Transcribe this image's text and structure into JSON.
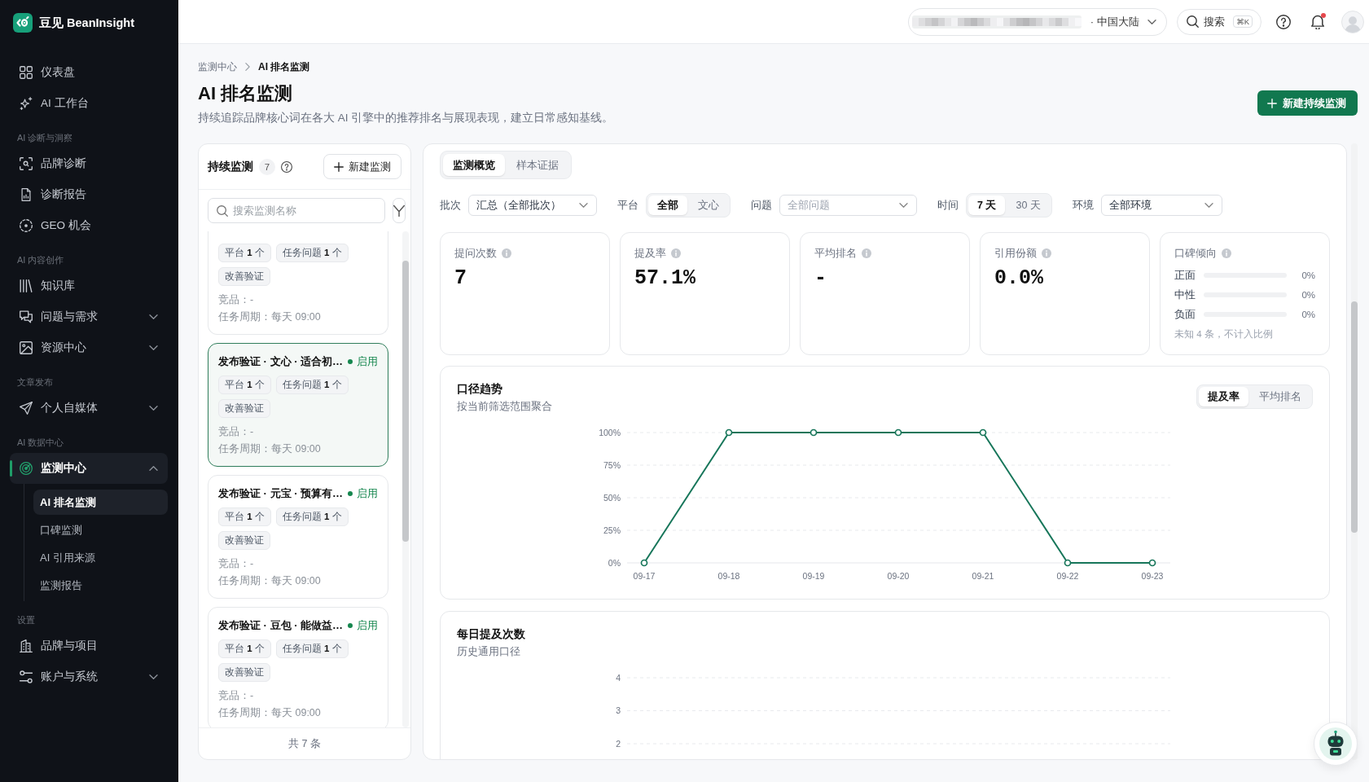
{
  "sidebar": {
    "brand": "豆见 BeanInsight",
    "sections": [
      {
        "items": [
          {
            "label": "仪表盘",
            "selected": false
          },
          {
            "label": "AI 工作台",
            "selected": false
          }
        ]
      },
      {
        "title": "AI 诊断与洞察",
        "items": [
          {
            "label": "品牌诊断",
            "selected": false
          },
          {
            "label": "诊断报告",
            "selected": false
          },
          {
            "label": "GEO 机会",
            "selected": false
          }
        ]
      },
      {
        "title": "AI 内容创作",
        "items": [
          {
            "label": "知识库",
            "selected": false
          },
          {
            "label": "问题与需求",
            "selected": false,
            "expanded": false
          },
          {
            "label": "资源中心",
            "selected": false,
            "expanded": false
          }
        ]
      },
      {
        "title": "文章发布",
        "items": [
          {
            "label": "个人自媒体",
            "selected": false,
            "expanded": false
          }
        ]
      },
      {
        "title": "AI 数据中心",
        "items": [
          {
            "label": "监测中心",
            "selected": true,
            "expanded": true,
            "children": [
              {
                "label": "AI 排名监测",
                "selected": true
              },
              {
                "label": "口碑监测",
                "selected": false
              },
              {
                "label": "AI 引用来源",
                "selected": false
              },
              {
                "label": "监测报告",
                "selected": false
              }
            ]
          }
        ]
      },
      {
        "title": "设置",
        "items": [
          {
            "label": "品牌与项目",
            "selected": false
          },
          {
            "label": "账户与系统",
            "selected": false,
            "expanded": false
          }
        ]
      }
    ]
  },
  "header": {
    "region": "· 中国大陆",
    "search": {
      "label": "搜索",
      "shortcut": "⌘K"
    },
    "notifications": {
      "unread": true
    }
  },
  "page": {
    "breadcrumb": [
      "监测中心",
      "AI 排名监测"
    ],
    "title": "AI 排名监测",
    "subtitle": "持续追踪品牌核心词在各大 AI 引擎中的推荐排名与展现表现，建立日常感知基线。",
    "primary_button": "新建持续监测"
  },
  "monitors": {
    "title": "持续监测",
    "count": "7",
    "new_button": "新建监测",
    "search": {
      "placeholder": "搜索监测名称"
    },
    "items": [
      {
        "kind": "partial",
        "selected": false,
        "tags": [
          "平台 **1** 个",
          "任务问题 **1** 个",
          "改善验证"
        ],
        "competitors": "竞品：-",
        "schedule": "任务周期：每天 09:00"
      },
      {
        "kind": "full",
        "selected": true,
        "title": "发布验证 · 文心 · 适合初…",
        "status": "启用",
        "tags": [
          "平台 **1** 个",
          "任务问题 **1** 个",
          "改善验证"
        ],
        "competitors": "竞品：-",
        "schedule": "任务周期：每天 09:00"
      },
      {
        "kind": "full",
        "selected": false,
        "title": "发布验证 · 元宝 · 预算有…",
        "status": "启用",
        "tags": [
          "平台 **1** 个",
          "任务问题 **1** 个",
          "改善验证"
        ],
        "competitors": "竞品：-",
        "schedule": "任务周期：每天 09:00"
      },
      {
        "kind": "full",
        "selected": false,
        "title": "发布验证 · 豆包 · 能做益…",
        "status": "启用",
        "tags": [
          "平台 **1** 个",
          "任务问题 **1** 个",
          "改善验证"
        ],
        "competitors": "竞品：-",
        "schedule": "任务周期：每天 09:00"
      }
    ],
    "total": "共 7 条"
  },
  "overview": {
    "tabs": [
      {
        "label": "监测概览",
        "selected": true
      },
      {
        "label": "样本证据",
        "selected": false
      }
    ],
    "filters": [
      {
        "kind": "select",
        "label": "批次",
        "value": "汇总（全部批次）"
      },
      {
        "kind": "segmented",
        "label": "平台",
        "options": [
          {
            "label": "全部",
            "selected": true
          },
          {
            "label": "文心",
            "selected": false
          }
        ]
      },
      {
        "kind": "select",
        "label": "问题",
        "placeholder": "全部问题"
      },
      {
        "kind": "segmented",
        "label": "时间",
        "options": [
          {
            "label": "7 天",
            "selected": true
          },
          {
            "label": "30 天",
            "selected": false
          }
        ]
      },
      {
        "kind": "select",
        "label": "环境",
        "value": "全部环境"
      }
    ],
    "stats": [
      {
        "kind": "number",
        "label": "提问次数",
        "value": "7"
      },
      {
        "kind": "number",
        "label": "提及率",
        "value": "57.1%"
      },
      {
        "kind": "number",
        "label": "平均排名",
        "value": "-"
      },
      {
        "kind": "number",
        "label": "引用份额",
        "value": "0.0%"
      },
      {
        "kind": "sentiment",
        "label": "口碑倾向",
        "rows": [
          {
            "label": "正面",
            "reading": "0%"
          },
          {
            "label": "中性",
            "reading": "0%"
          },
          {
            "label": "负面",
            "reading": "0%"
          }
        ],
        "note": "未知 4 条，不计入比例"
      }
    ],
    "trend": {
      "title": "口径趋势",
      "subtitle": "按当前筛选范围聚合",
      "toggle": [
        {
          "label": "提及率",
          "selected": true
        },
        {
          "label": "平均排名",
          "selected": false
        }
      ],
      "chart_data": {
        "type": "line",
        "grid": true,
        "categories": [
          "09-17",
          "09-18",
          "09-19",
          "09-20",
          "09-21",
          "09-22",
          "09-23"
        ],
        "series": [
          {
            "color": "#17765a",
            "marker": "circle",
            "values": [
              0,
              100,
              100,
              100,
              100,
              0,
              0
            ]
          }
        ],
        "ylim": [
          0,
          100
        ],
        "yticks": [
          {
            "value": 100,
            "label": "100%"
          },
          {
            "value": 75,
            "label": "75%"
          },
          {
            "value": 50,
            "label": "50%"
          },
          {
            "value": 25,
            "label": "25%"
          },
          {
            "value": 0,
            "label": "0%"
          }
        ]
      }
    },
    "daily": {
      "title": "每日提及次数",
      "subtitle": "历史通用口径",
      "y_tick_labels": [
        "4",
        "3",
        "2"
      ]
    }
  }
}
